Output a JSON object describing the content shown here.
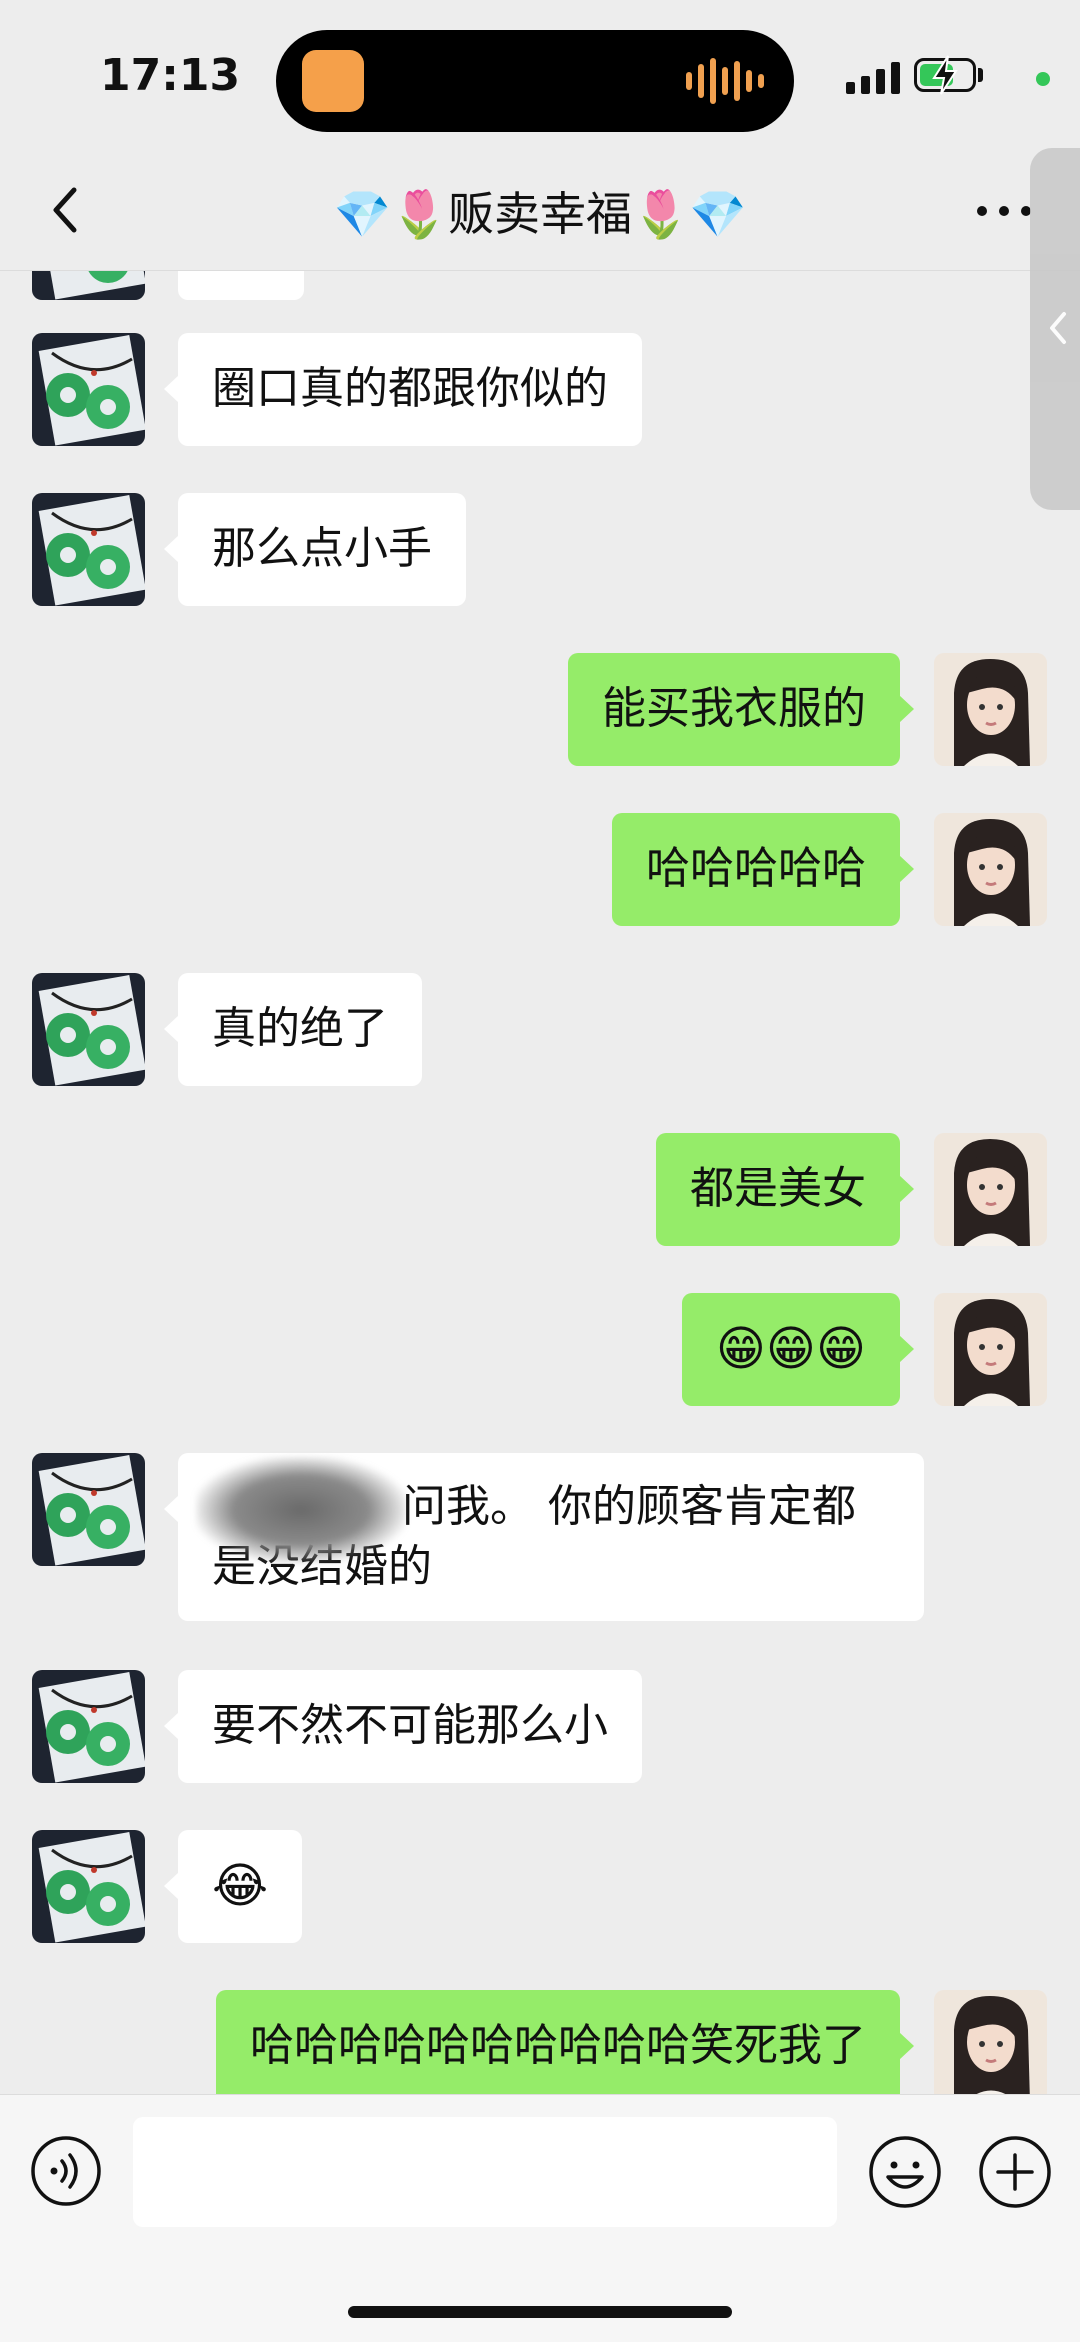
{
  "status_bar": {
    "time": "17:13",
    "battery_level": 0.65,
    "colors": {
      "battery": "#34c759",
      "island_app": "#f5a04a",
      "privacy_dot": "#34c759"
    }
  },
  "nav": {
    "title": "💎🌷贩卖幸福🌷💎",
    "back_icon": "chevron-left-icon",
    "more_icon": "more-dots-icon"
  },
  "side_panel": {
    "icon": "chevron-left-icon"
  },
  "messages": [
    {
      "sender": "other",
      "text": "圈口真的都跟你似的"
    },
    {
      "sender": "other",
      "text": "那么点小手"
    },
    {
      "sender": "me",
      "text": "能买我衣服的"
    },
    {
      "sender": "me",
      "text": "哈哈哈哈哈"
    },
    {
      "sender": "other",
      "text": "真的绝了"
    },
    {
      "sender": "me",
      "text": "都是美女"
    },
    {
      "sender": "me",
      "text": "😁😁😁"
    },
    {
      "sender": "other",
      "text": "问我。 你的顾客肯定都是没结婚的"
    },
    {
      "sender": "other",
      "text": "要不然不可能那么小"
    },
    {
      "sender": "other",
      "text": "😂"
    },
    {
      "sender": "me",
      "text": "哈哈哈哈哈哈哈哈哈哈笑死我了"
    }
  ],
  "input_bar": {
    "voice_icon": "voice-icon",
    "emoji_icon": "emoji-icon",
    "plus_icon": "plus-icon",
    "input_value": ""
  },
  "colors": {
    "background": "#ededed",
    "bubble_me": "#95ec69",
    "bubble_other": "#ffffff"
  }
}
